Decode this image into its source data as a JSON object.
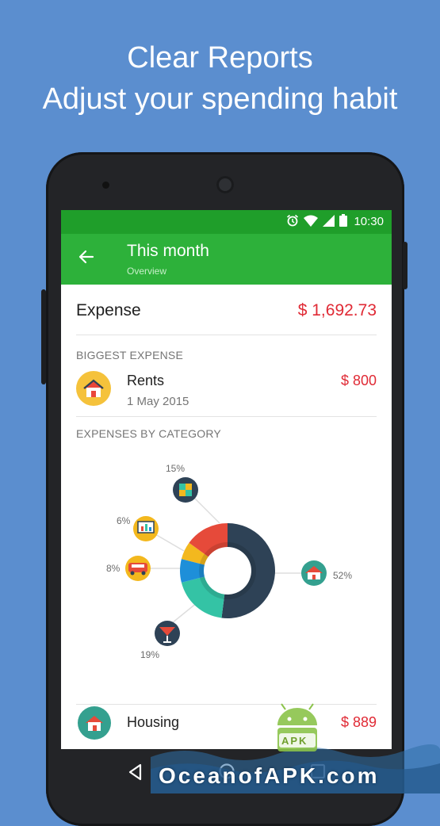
{
  "promo": {
    "line1": "Clear Reports",
    "line2": "Adjust your spending habit"
  },
  "status_bar": {
    "time": "10:30"
  },
  "app_bar": {
    "title": "This month",
    "subtitle": "Overview"
  },
  "expense": {
    "label": "Expense",
    "total": "$ 1,692.73"
  },
  "biggest_expense": {
    "section_title": "BIGGEST EXPENSE",
    "name": "Rents",
    "date": "1 May 2015",
    "amount": "$ 800",
    "icon": "house-icon"
  },
  "by_category": {
    "section_title": "EXPENSES BY CATEGORY",
    "labels": {
      "housing": "52%",
      "dining": "19%",
      "transport": "8%",
      "presentation": "6%",
      "gifts": "15%"
    }
  },
  "chart_data": {
    "type": "pie",
    "categories": [
      "Housing",
      "Dining",
      "Transport",
      "Presentation",
      "Gifts"
    ],
    "values": [
      52,
      19,
      8,
      6,
      15
    ],
    "colors": [
      "#2e4256",
      "#34c3a5",
      "#1e8fd9",
      "#f3b81e",
      "#e64a3a"
    ]
  },
  "category_list": [
    {
      "name": "Housing",
      "amount": "$ 889",
      "icon": "house-icon"
    }
  ],
  "navbar": {
    "back_icon": "back-triangle-icon",
    "home_icon": "home-circle-icon",
    "recents_icon": "recents-square-icon"
  },
  "watermark": {
    "text": "OceanofAPK.com",
    "badge": "APK"
  },
  "colors": {
    "accent_green": "#2db13a",
    "status_green": "#1f9e2a",
    "expense_red": "#e02a35",
    "background_blue": "#5b8ecf"
  }
}
